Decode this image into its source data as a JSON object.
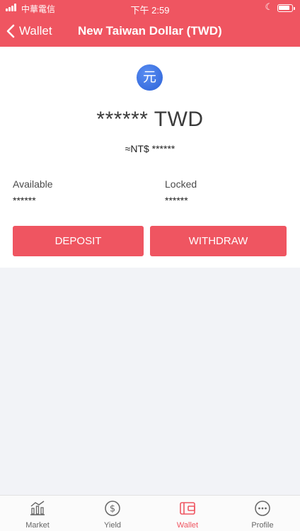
{
  "status_bar": {
    "carrier": "中華電信",
    "time": "下午 2:59"
  },
  "nav": {
    "back_label": "Wallet",
    "title": "New Taiwan Dollar (TWD)"
  },
  "currency": {
    "icon_glyph": "元",
    "balance": "****** TWD",
    "approx_value": "≈NT$ ******"
  },
  "stats": {
    "available_label": "Available",
    "available_value": "******",
    "locked_label": "Locked",
    "locked_value": "******"
  },
  "actions": {
    "deposit_label": "DEPOSIT",
    "withdraw_label": "WITHDRAW"
  },
  "tabbar": {
    "active_tab": "Wallet",
    "tabs": [
      {
        "label": "Market",
        "icon": "chart-icon"
      },
      {
        "label": "Yield",
        "icon": "dollar-coin-icon"
      },
      {
        "label": "Wallet",
        "icon": "wallet-icon"
      },
      {
        "label": "Profile",
        "icon": "more-icon"
      }
    ]
  },
  "colors": {
    "brand": "#ef5561",
    "coin_blue": "#2c62d8",
    "background": "#f2f3f7"
  }
}
